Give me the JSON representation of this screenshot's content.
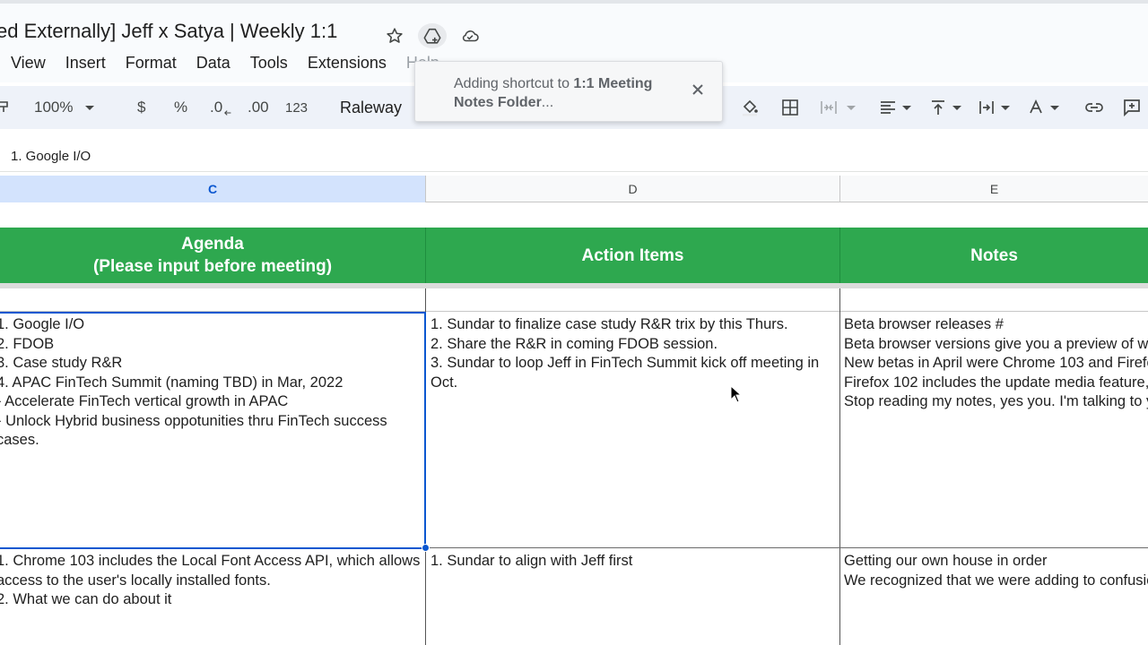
{
  "document": {
    "title": "ed Externally] Jeff x Satya | Weekly 1:1"
  },
  "title_icons": [
    "star-icon",
    "add-shortcut-drive-icon",
    "cloud-saved-icon"
  ],
  "menu": [
    "View",
    "Insert",
    "Format",
    "Data",
    "Tools",
    "Extensions",
    "Help"
  ],
  "toolbar": {
    "zoom": "100%",
    "currency": "$",
    "percent": "%",
    "decrease_decimal": ".0",
    "increase_decimal": ".00",
    "number_format": "123",
    "font": "Raleway"
  },
  "toast": {
    "prefix": "Adding shortcut to ",
    "bold": "1:1 Meeting Notes Folder",
    "suffix": "..."
  },
  "formula_bar": {
    "value": "1. Google I/O"
  },
  "columns": [
    "C",
    "D",
    "E"
  ],
  "header_row": {
    "agenda_line1": "Agenda",
    "agenda_line2": "(Please input before meeting)",
    "action_items": "Action Items",
    "notes": "Notes"
  },
  "rows": [
    {
      "agenda": "1. Google I/O\n2. FDOB\n3. Case study R&R\n4. APAC FinTech Summit (naming TBD) in Mar, 2022\n- Accelerate FinTech vertical growth in APAC\n- Unlock Hybrid business oppotunities thru FinTech success cases.",
      "action_items": "1. Sundar to finalize case study R&R trix by this Thurs.\n2. Share the R&R in coming FDOB session.\n3. Sundar to loop Jeff in FinTech Summit kick off meeting in Oct.",
      "notes": "Beta browser releases #\nBeta browser versions give you a preview of what will be in the next stable version of the browser. It's a great time to test new features, or removals, that could impact your site before the world gets that release.\nNew betas in April were Chrome 103 and Firefox 102.\nFirefox 102 includes the update media feature, used to query whether the output device can modify the appearance of content once it has been rendered. It accepts the following values:\nStop reading my notes, yes you. I'm talking to you."
    },
    {
      "agenda": "1. Chrome 103 includes the Local Font Access API, which allows access to the user's locally installed fonts.\n2. What we can do about it",
      "action_items": "1. Sundar to align with Jeff first",
      "notes": "Getting our own house in order\nWe recognized that we were adding to confusion about the status of features, mixing experimental and stable content on our sites. So, we've improved the clarity of our own communication channels."
    }
  ]
}
